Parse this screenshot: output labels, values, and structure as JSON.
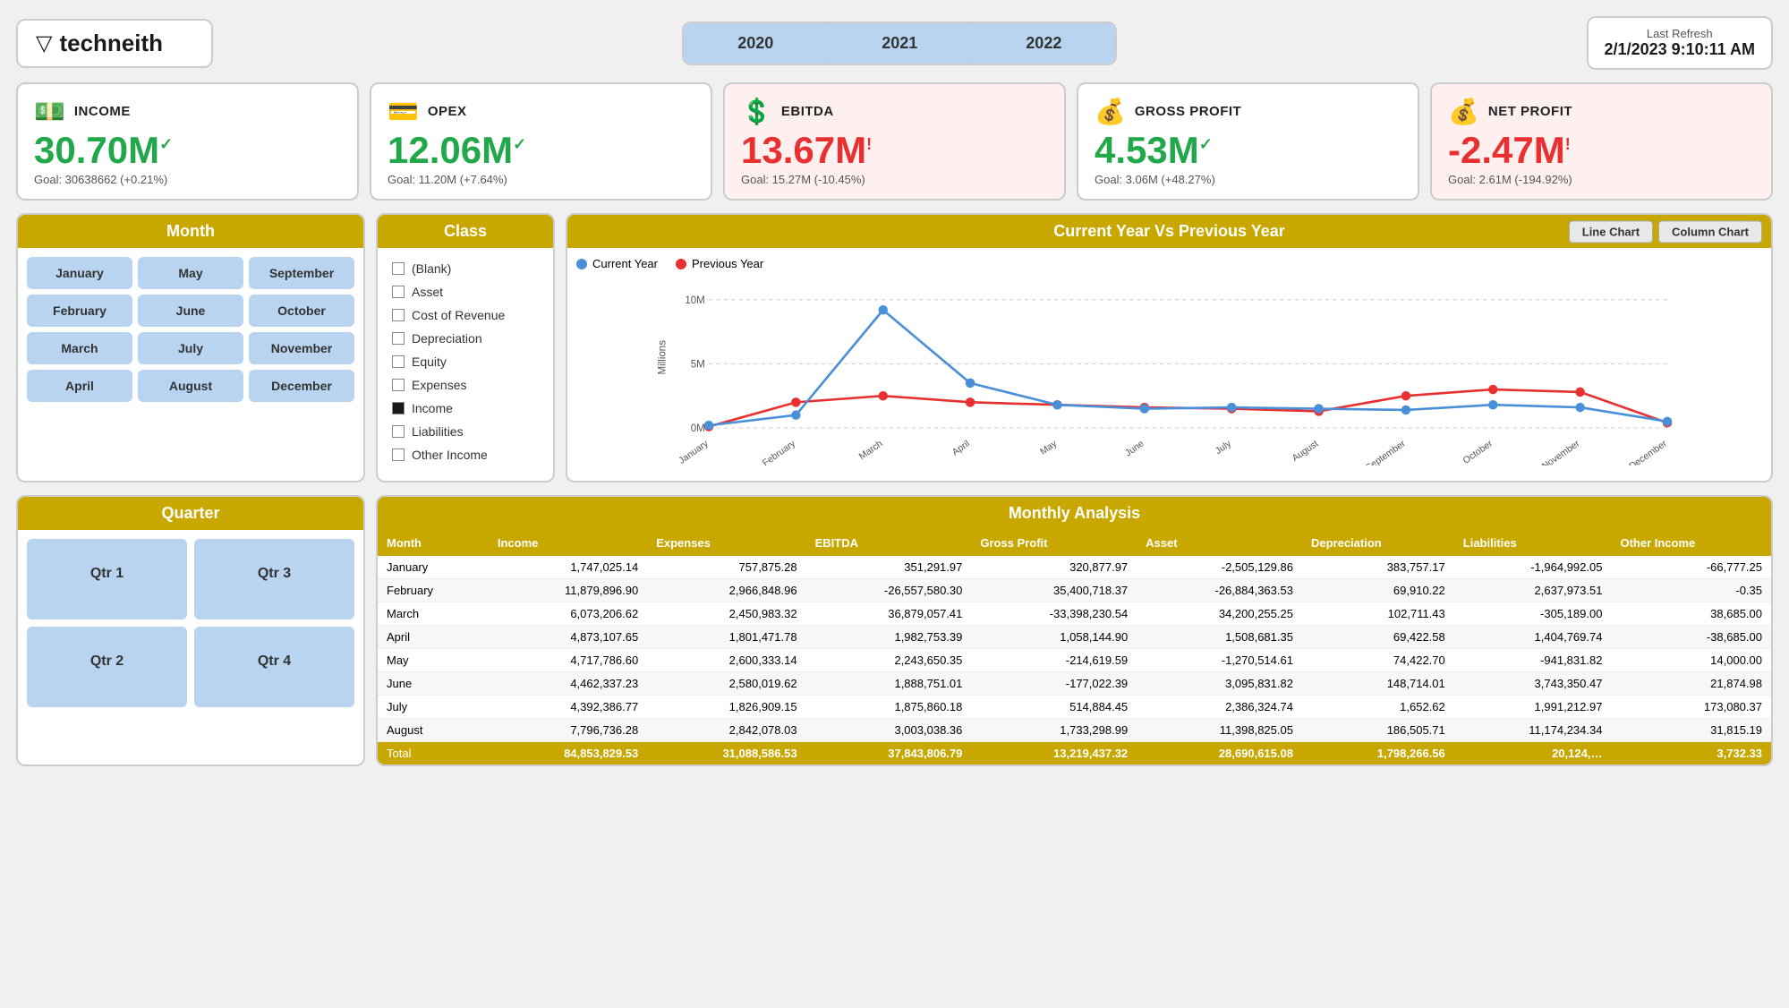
{
  "header": {
    "logo_text": "techneith",
    "year_tabs": [
      "2020",
      "2021",
      "2022"
    ],
    "refresh_label": "Last Refresh",
    "refresh_value": "2/1/2023 9:10:11 AM"
  },
  "kpis": [
    {
      "id": "income",
      "icon": "💵",
      "title": "INCOME",
      "value": "30.70M",
      "value_class": "green",
      "check": "✓",
      "goal": "Goal: 30638662 (+0.21%)"
    },
    {
      "id": "opex",
      "icon": "💳",
      "title": "OPEX",
      "value": "12.06M",
      "value_class": "green",
      "check": "✓",
      "goal": "Goal: 11.20M (+7.64%)"
    },
    {
      "id": "ebitda",
      "icon": "💲",
      "title": "EBITDA",
      "value": "13.67M",
      "value_class": "red",
      "check": "!",
      "goal": "Goal: 15.27M (-10.45%)",
      "red_bg": true
    },
    {
      "id": "gross_profit",
      "icon": "💰",
      "title": "GROSS PROFIT",
      "value": "4.53M",
      "value_class": "green",
      "check": "✓",
      "goal": "Goal: 3.06M (+48.27%)"
    },
    {
      "id": "net_profit",
      "icon": "💰",
      "title": "NET PROFIT",
      "value": "-2.47M",
      "value_class": "red",
      "check": "!",
      "goal": "Goal: 2.61M (-194.92%)",
      "red_bg": true
    }
  ],
  "month_panel": {
    "title": "Month",
    "months": [
      [
        "January",
        "May",
        "September"
      ],
      [
        "February",
        "June",
        "October"
      ],
      [
        "March",
        "July",
        "November"
      ],
      [
        "April",
        "August",
        "December"
      ]
    ]
  },
  "class_panel": {
    "title": "Class",
    "items": [
      {
        "label": "(Blank)",
        "checked": false
      },
      {
        "label": "Asset",
        "checked": false
      },
      {
        "label": "Cost of Revenue",
        "checked": false
      },
      {
        "label": "Depreciation",
        "checked": false
      },
      {
        "label": "Equity",
        "checked": false
      },
      {
        "label": "Expenses",
        "checked": false
      },
      {
        "label": "Income",
        "checked": true
      },
      {
        "label": "Liabilities",
        "checked": false
      },
      {
        "label": "Other Income",
        "checked": false
      }
    ]
  },
  "chart": {
    "title": "Current Year Vs Previous Year",
    "btn_line": "Line Chart",
    "btn_column": "Column Chart",
    "legend_current": "Current Year",
    "legend_previous": "Previous Year",
    "months_x": [
      "January",
      "February",
      "March",
      "April",
      "May",
      "June",
      "July",
      "August",
      "September",
      "October",
      "November",
      "December"
    ],
    "current_year_values": [
      0.2,
      1.0,
      9.2,
      3.5,
      1.8,
      1.5,
      1.6,
      1.5,
      1.4,
      1.8,
      1.6,
      0.5
    ],
    "previous_year_values": [
      0.1,
      2.0,
      2.5,
      2.0,
      1.8,
      1.6,
      1.5,
      1.3,
      2.5,
      3.0,
      2.8,
      0.4
    ],
    "y_labels": [
      "0M",
      "5M",
      "10M"
    ],
    "y_axis_label": "Millions"
  },
  "quarter_panel": {
    "title": "Quarter",
    "quarters": [
      [
        "Qtr 1",
        "Qtr 3"
      ],
      [
        "Qtr 2",
        "Qtr 4"
      ]
    ]
  },
  "table": {
    "title": "Monthly Analysis",
    "columns": [
      "Month",
      "Income",
      "Expenses",
      "EBITDA",
      "Gross Profit",
      "Asset",
      "Depreciation",
      "Liabilities",
      "Other Income"
    ],
    "rows": [
      [
        "January",
        "1,747,025.14",
        "757,875.28",
        "351,291.97",
        "320,877.97",
        "-2,505,129.86",
        "383,757.17",
        "-1,964,992.05",
        "-66,777.25"
      ],
      [
        "February",
        "11,879,896.90",
        "2,966,848.96",
        "-26,557,580.30",
        "35,400,718.37",
        "-26,884,363.53",
        "69,910.22",
        "2,637,973.51",
        "-0.35"
      ],
      [
        "March",
        "6,073,206.62",
        "2,450,983.32",
        "36,879,057.41",
        "-33,398,230.54",
        "34,200,255.25",
        "102,711.43",
        "-305,189.00",
        "38,685.00"
      ],
      [
        "April",
        "4,873,107.65",
        "1,801,471.78",
        "1,982,753.39",
        "1,058,144.90",
        "1,508,681.35",
        "69,422.58",
        "1,404,769.74",
        "-38,685.00"
      ],
      [
        "May",
        "4,717,786.60",
        "2,600,333.14",
        "2,243,650.35",
        "-214,619.59",
        "-1,270,514.61",
        "74,422.70",
        "-941,831.82",
        "14,000.00"
      ],
      [
        "June",
        "4,462,337.23",
        "2,580,019.62",
        "1,888,751.01",
        "-177,022.39",
        "3,095,831.82",
        "148,714.01",
        "3,743,350.47",
        "21,874.98"
      ],
      [
        "July",
        "4,392,386.77",
        "1,826,909.15",
        "1,875,860.18",
        "514,884.45",
        "2,386,324.74",
        "1,652.62",
        "1,991,212.97",
        "173,080.37"
      ],
      [
        "August",
        "7,796,736.28",
        "2,842,078.03",
        "3,003,038.36",
        "1,733,298.99",
        "11,398,825.05",
        "186,505.71",
        "11,174,234.34",
        "31,815.19"
      ]
    ],
    "total_row": [
      "Total",
      "84,853,829.53",
      "31,088,586.53",
      "37,843,806.79",
      "13,219,437.32",
      "28,690,615.08",
      "1,798,266.56",
      "20,124,…",
      "3,732.33"
    ]
  }
}
